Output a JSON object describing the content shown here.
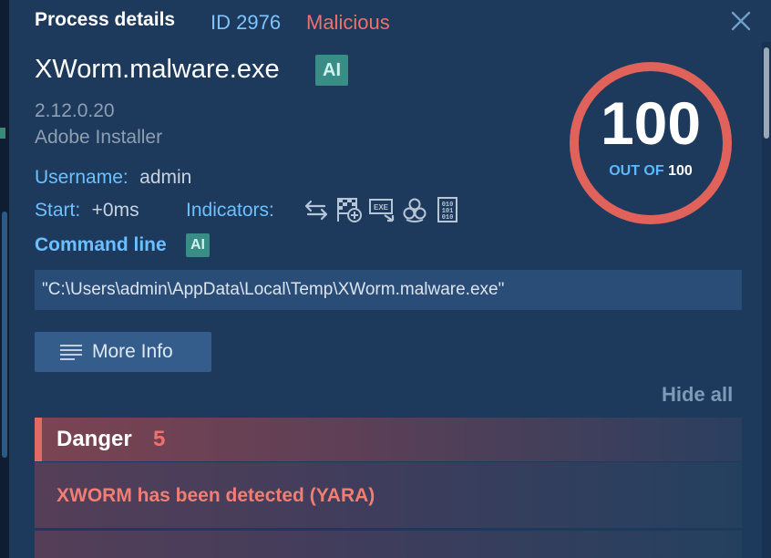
{
  "header": {
    "title": "Process details",
    "pid": "ID 2976",
    "verdict": "Malicious",
    "verdict_color": "#f0706a",
    "close_icon": "close-icon"
  },
  "process": {
    "name": "XWorm.malware.exe",
    "ai_badge": "AI",
    "version": "2.12.0.20",
    "vendor": "Adobe Installer"
  },
  "details": {
    "username_label": "Username:",
    "username": "admin",
    "start_label": "Start:",
    "start": "+0ms",
    "indicators_label": "Indicators:",
    "indicator_icons": [
      "network-arrows-icon",
      "add-flag-icon",
      "exe-drop-icon",
      "biohazard-icon",
      "binary-file-icon"
    ],
    "command_line_label": "Command line",
    "command_line_ai": "AI",
    "command_line": "\"C:\\Users\\admin\\AppData\\Local\\Temp\\XWorm.malware.exe\""
  },
  "score": {
    "value": "100",
    "out_of_label": "OUT OF",
    "out_of_value": "100",
    "ring_color": "#e0625b"
  },
  "actions": {
    "more_info": "More Info",
    "hide_all": "Hide all"
  },
  "danger": {
    "title": "Danger",
    "count": "5",
    "items": [
      "XWORM has been detected (YARA)"
    ]
  }
}
